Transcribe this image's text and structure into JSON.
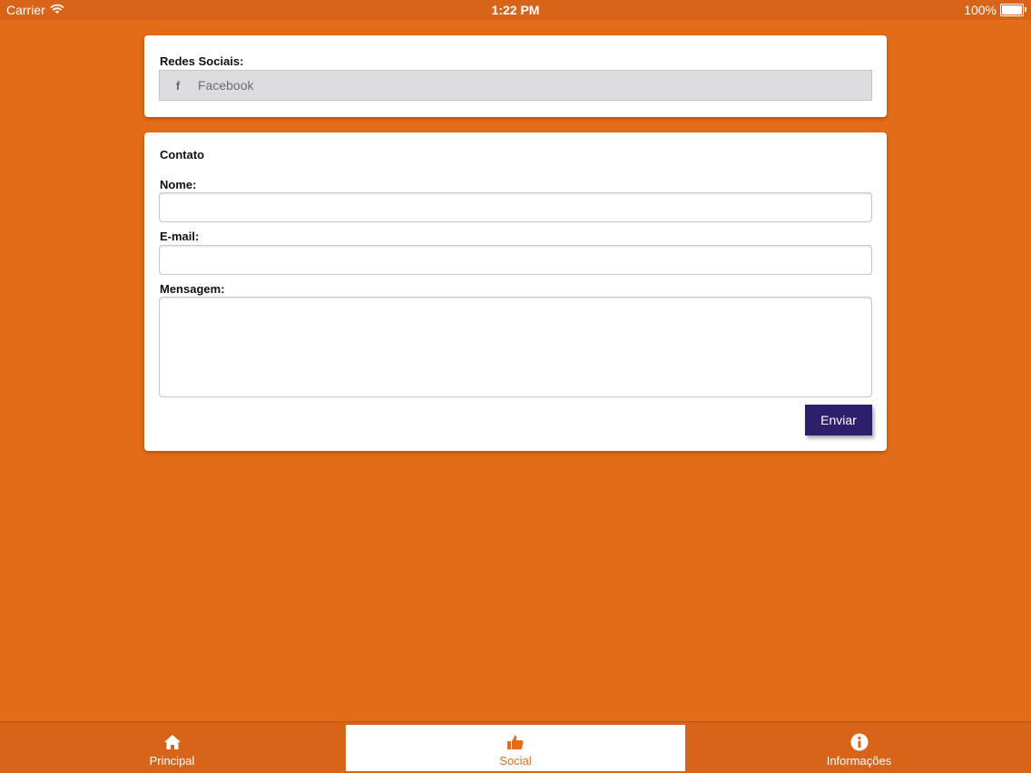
{
  "status_bar": {
    "carrier": "Carrier",
    "time": "1:22 PM",
    "battery": "100%",
    "battery_level": 1.0
  },
  "social": {
    "title": "Redes Sociais:",
    "facebook_icon": "f",
    "facebook_label": "Facebook"
  },
  "contact": {
    "title": "Contato",
    "name_label": "Nome:",
    "name_value": "",
    "email_label": "E-mail:",
    "email_value": "",
    "message_label": "Mensagem:",
    "message_value": "",
    "send_label": "Enviar"
  },
  "tabs": [
    {
      "label": "Principal",
      "icon": "home-icon",
      "active": false
    },
    {
      "label": "Social",
      "icon": "thumbs-up-icon",
      "active": true
    },
    {
      "label": "Informações",
      "icon": "info-icon",
      "active": false
    }
  ],
  "colors": {
    "background": "#e36c19",
    "bar": "#d8641a",
    "button": "#2e1f6c",
    "active_tab_text": "#e36c19"
  }
}
